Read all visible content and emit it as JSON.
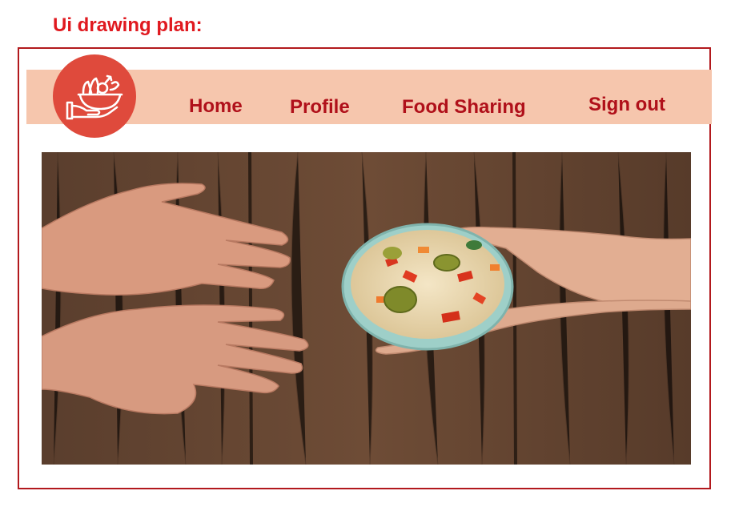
{
  "heading": "Ui drawing plan:",
  "nav": {
    "home": "Home",
    "profile": "Profile",
    "food_sharing": "Food Sharing",
    "sign_out": "Sign out"
  },
  "logo_icon": "hand-holding-food-bowl-icon",
  "hero_image": "hands-sharing-rice-bowl-on-wooden-table",
  "colors": {
    "accent": "#e0191f",
    "nav_text": "#b0101a",
    "nav_bg": "#f6c6ad",
    "logo_bg": "#df4a3c",
    "frame": "#b2191d"
  }
}
